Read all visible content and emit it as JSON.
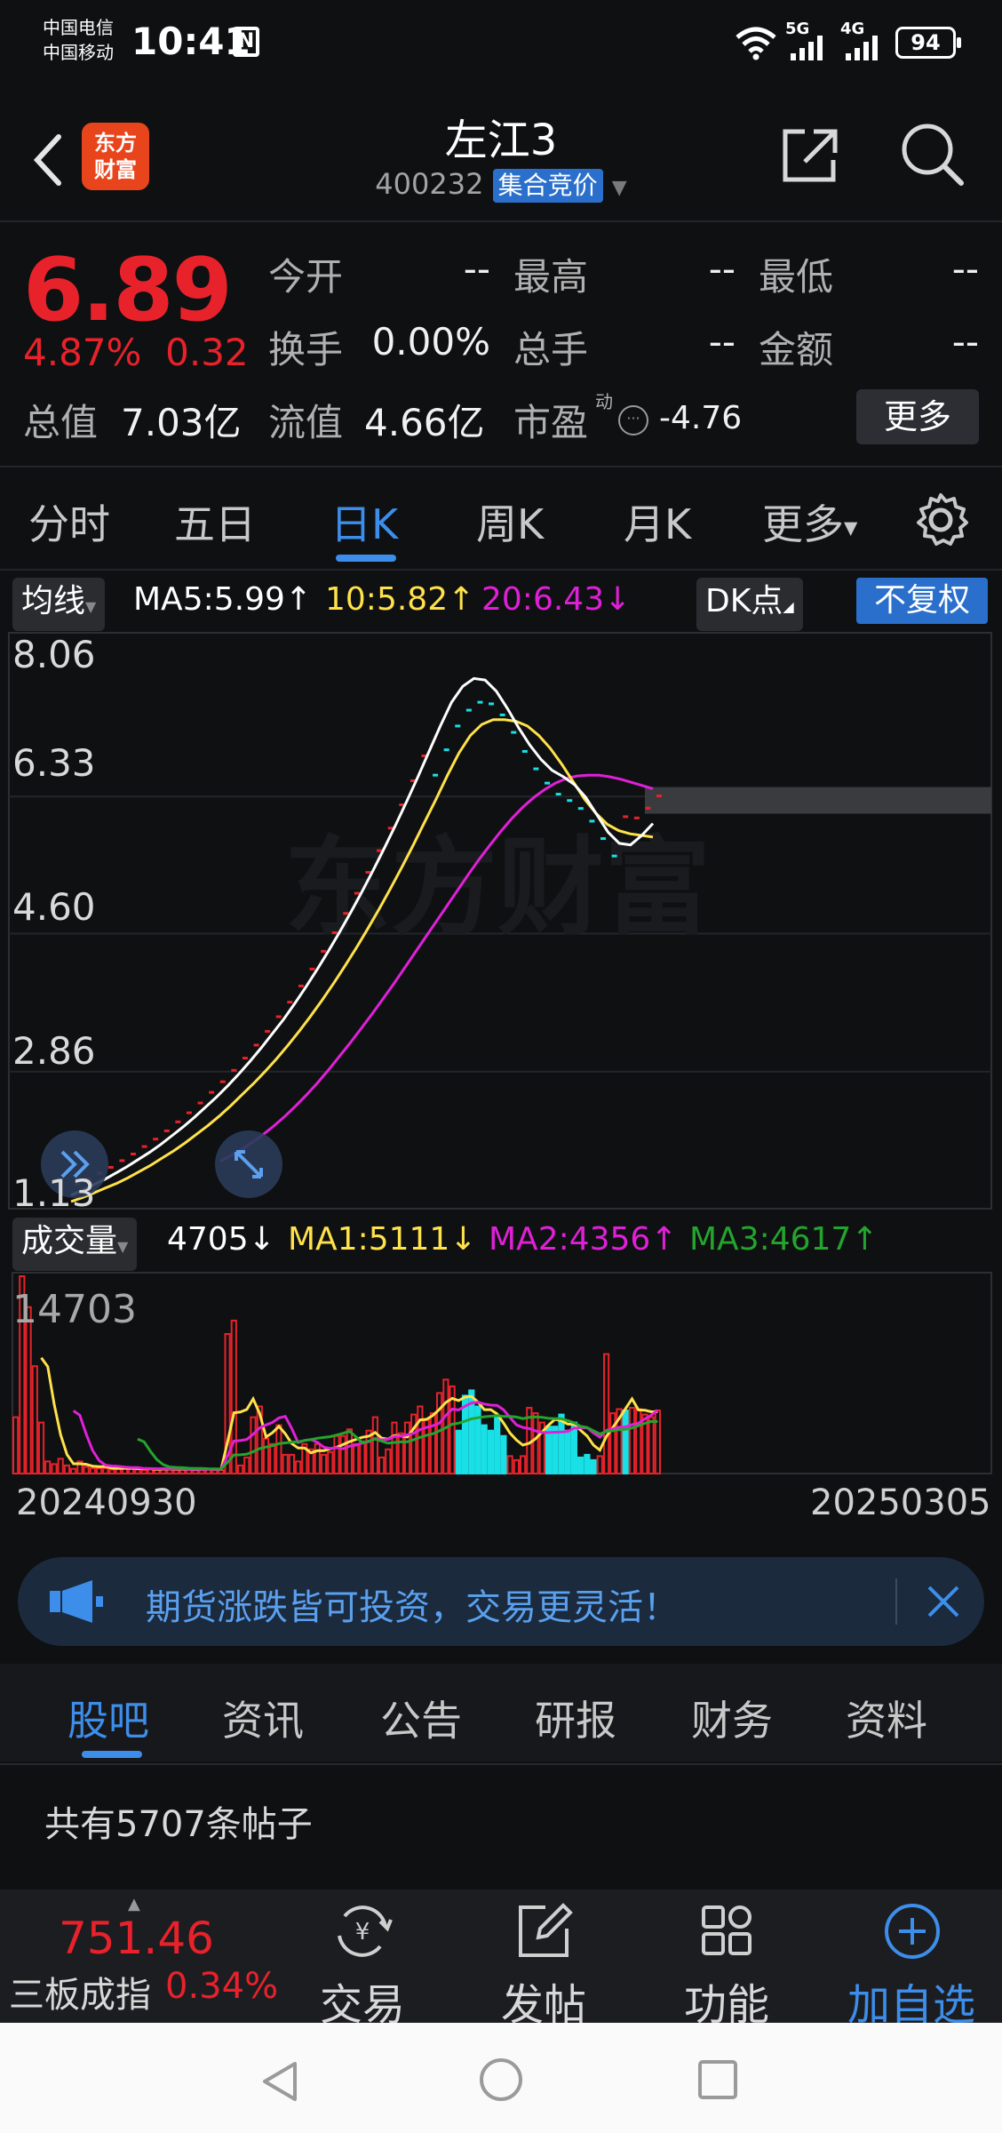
{
  "status_bar": {
    "carrier1": "中国电信",
    "carrier2": "中国移动",
    "time": "10:41",
    "nfc": "N",
    "net1": "5G",
    "net2": "4G",
    "battery": "94"
  },
  "header": {
    "logo_line1": "东方",
    "logo_line2": "财富",
    "title": "左江3",
    "code": "400232",
    "auction_badge": "集合竞价"
  },
  "quote": {
    "price": "6.89",
    "change_pct": "4.87%",
    "change_amt": "0.32",
    "open_label": "今开",
    "open_value": "--",
    "high_label": "最高",
    "high_value": "--",
    "low_label": "最低",
    "low_value": "--",
    "turnover_label": "换手",
    "turnover_value": "0.00%",
    "volume_label": "总手",
    "volume_value": "--",
    "amount_label": "金额",
    "amount_value": "--",
    "mcap_label": "总值",
    "mcap_value": "7.03亿",
    "float_label": "流值",
    "float_value": "4.66亿",
    "pe_label": "市盈",
    "pe_sup": "动",
    "pe_value": "-4.76",
    "more_button": "更多"
  },
  "period_tabs": [
    "分时",
    "五日",
    "日K",
    "周K",
    "月K",
    "更多"
  ],
  "active_period": "日K",
  "ma": {
    "selector": "均线",
    "ma5": "MA5:5.99↑",
    "ma10": "10:5.82↑",
    "ma20": "20:6.43↓",
    "dk": "DK点",
    "adjust": "不复权"
  },
  "price_axis": [
    "8.06",
    "6.33",
    "4.60",
    "2.86",
    "1.13"
  ],
  "watermark": "东方财富",
  "volume_header": {
    "selector": "成交量",
    "vol": "4705↓",
    "ma1": "MA1:5111↓",
    "ma2": "MA2:4356↑",
    "ma3": "MA3:4617↑"
  },
  "volume_axis_top": "14703",
  "dates": {
    "start": "20240930",
    "end": "20250305"
  },
  "banner": {
    "text": "期货涨跌皆可投资，交易更灵活！"
  },
  "news_tabs": [
    "股吧",
    "资讯",
    "公告",
    "研报",
    "财务",
    "资料"
  ],
  "active_news_tab": "股吧",
  "posts_count": "共有5707条帖子",
  "toolbar": {
    "index_value": "751.46",
    "index_name": "三板成指",
    "index_pct": "0.34%",
    "trade": "交易",
    "post": "发帖",
    "functions": "功能",
    "add_watch": "加自选"
  },
  "colors": {
    "up": "#e8222a",
    "accent": "#3d8eea",
    "ma5": "#ffffff",
    "ma10": "#ffe24a",
    "ma20": "#e020d8",
    "ma3_vol": "#23a52d",
    "down_bar": "#19e0e6"
  },
  "chart_data": {
    "type": "bar",
    "price_range": [
      1.13,
      8.06
    ],
    "volume_range": [
      0,
      14703
    ],
    "x_start": "20240930",
    "x_end": "20250305",
    "ma5": [
      1.3,
      1.36,
      1.43,
      1.5,
      1.58,
      1.66,
      1.75,
      1.84,
      1.94,
      2.05,
      2.16,
      2.28,
      2.41,
      2.54,
      2.68,
      2.83,
      2.99,
      3.16,
      3.34,
      3.52,
      3.72,
      3.93,
      4.15,
      4.38,
      4.62,
      4.87,
      5.13,
      5.4,
      5.68,
      5.97,
      6.27,
      6.58,
      6.9,
      7.22,
      7.52,
      7.72,
      7.82,
      7.8,
      7.66,
      7.44,
      7.2,
      6.98,
      6.8,
      6.66,
      6.58,
      6.48,
      6.32,
      6.1,
      5.88,
      5.74,
      5.72,
      5.84,
      5.99
    ],
    "ma10": [
      1.22,
      1.27,
      1.33,
      1.39,
      1.45,
      1.52,
      1.6,
      1.68,
      1.77,
      1.86,
      1.96,
      2.07,
      2.18,
      2.3,
      2.43,
      2.57,
      2.71,
      2.86,
      3.02,
      3.19,
      3.37,
      3.56,
      3.76,
      3.97,
      4.19,
      4.42,
      4.66,
      4.91,
      5.17,
      5.44,
      5.72,
      6.01,
      6.3,
      6.6,
      6.88,
      7.1,
      7.24,
      7.3,
      7.3,
      7.28,
      7.22,
      7.1,
      6.94,
      6.74,
      6.52,
      6.3,
      6.12,
      5.98,
      5.9,
      5.86,
      5.84,
      5.82
    ],
    "ma20": [
      1.73,
      1.8,
      1.88,
      1.97,
      2.07,
      2.18,
      2.3,
      2.43,
      2.57,
      2.72,
      2.88,
      3.05,
      3.22,
      3.4,
      3.58,
      3.77,
      3.96,
      4.16,
      4.36,
      4.56,
      4.76,
      4.96,
      5.16,
      5.36,
      5.55,
      5.73,
      5.9,
      6.06,
      6.2,
      6.32,
      6.42,
      6.5,
      6.56,
      6.59,
      6.6,
      6.6,
      6.58,
      6.55,
      6.51,
      6.47,
      6.43
    ],
    "volume_bars": [
      4200,
      14703,
      12400,
      8000,
      3800,
      900,
      700,
      1100,
      600,
      350,
      900,
      500,
      400,
      400,
      400,
      300,
      400,
      500,
      350,
      300,
      250,
      400,
      300,
      400,
      300,
      250,
      300,
      320,
      280,
      400,
      350,
      250,
      260,
      10400,
      11400,
      600,
      1200,
      4200,
      5000,
      2600,
      2200,
      3600,
      1400,
      1400,
      900,
      2200,
      1800,
      2200,
      1400,
      1600,
      2800,
      2800,
      3300,
      2200,
      2400,
      3200,
      4200,
      1200,
      1800,
      3800,
      3000,
      3800,
      4400,
      5000,
      4000,
      4500,
      6000,
      7000,
      6500,
      3200,
      5800,
      6200,
      5000,
      3600,
      3200,
      4200,
      2800,
      1300,
      1000,
      1300,
      4900,
      4500,
      3800,
      3500,
      3500,
      4400,
      3200,
      3800,
      1200,
      1400,
      1000,
      1300,
      8900,
      4500,
      4800,
      4700,
      4900,
      4800,
      4400,
      4200,
      4700
    ],
    "volume_bar_down": [
      false,
      false,
      false,
      false,
      false,
      false,
      false,
      false,
      false,
      false,
      false,
      false,
      false,
      false,
      false,
      false,
      false,
      false,
      false,
      false,
      false,
      false,
      false,
      false,
      false,
      false,
      false,
      false,
      false,
      false,
      false,
      false,
      false,
      false,
      false,
      false,
      false,
      false,
      false,
      false,
      false,
      false,
      false,
      false,
      false,
      false,
      false,
      false,
      false,
      false,
      false,
      false,
      false,
      false,
      false,
      false,
      false,
      false,
      false,
      false,
      false,
      false,
      false,
      false,
      false,
      false,
      false,
      false,
      false,
      true,
      true,
      true,
      true,
      true,
      true,
      true,
      true,
      false,
      false,
      false,
      false,
      false,
      false,
      true,
      true,
      true,
      true,
      true,
      true,
      true,
      true,
      false,
      false,
      false,
      false,
      true,
      false,
      false,
      false,
      false,
      false,
      false,
      false
    ]
  }
}
